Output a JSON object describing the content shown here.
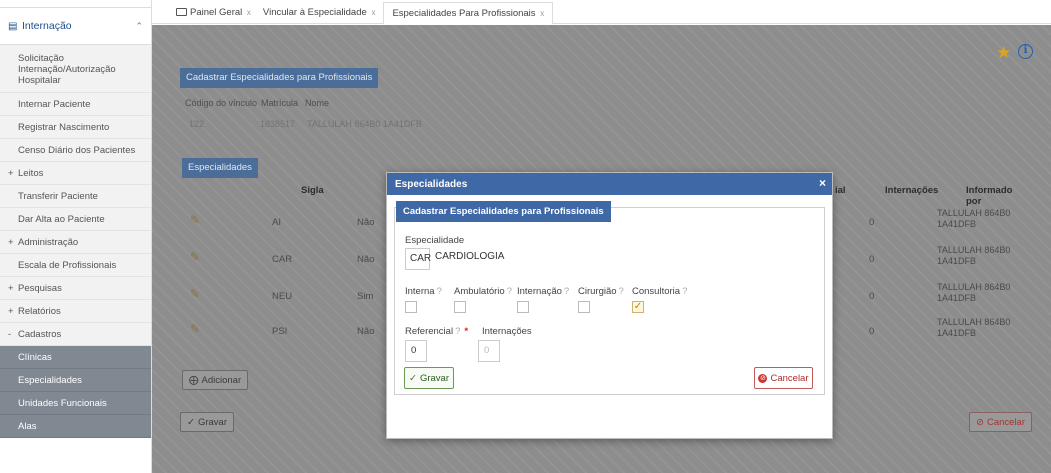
{
  "sidebar": {
    "header": "Internação",
    "items": [
      {
        "label": "Solicitação Internação/Autorização Hospitalar"
      },
      {
        "label": "Internar Paciente"
      },
      {
        "label": "Registrar Nascimento"
      },
      {
        "label": "Censo Diário dos Pacientes"
      },
      {
        "label": "Leitos",
        "sign": "+"
      },
      {
        "label": "Transferir Paciente"
      },
      {
        "label": "Dar Alta ao Paciente"
      },
      {
        "label": "Administração",
        "sign": "+"
      },
      {
        "label": "Escala de Profissionais"
      },
      {
        "label": "Pesquisas",
        "sign": "+"
      },
      {
        "label": "Relatórios",
        "sign": "+"
      },
      {
        "label": "Cadastros",
        "sign": "-"
      },
      {
        "label": "Clínicas"
      },
      {
        "label": "Especialidades"
      },
      {
        "label": "Unidades Funcionais"
      },
      {
        "label": "Alas"
      }
    ]
  },
  "tabs": [
    {
      "label": "Painel Geral",
      "close": "x"
    },
    {
      "label": "Vincular à Especialidade",
      "close": "x"
    },
    {
      "label": "Especialidades Para Profissionais",
      "close": "x"
    }
  ],
  "background": {
    "panel1_title": "Cadastrar Especialidades para Profissionais",
    "col_codigo": "Código do vínculo",
    "col_matricula": "Matrícula",
    "col_nome": "Nome",
    "val_codigo": "122",
    "val_matricula": "1838517",
    "val_nome": "TALLULAH 864B0 1A41DFB",
    "panel2_title": "Especialidades",
    "th_sigla": "Sigla",
    "th_partial": "ial",
    "th_internacoes": "Internações",
    "th_informado": "Informado por",
    "rows": [
      {
        "sigla": "AI",
        "flag": "Não",
        "intern": "0",
        "informado": "TALLULAH 864B0 1A41DFB"
      },
      {
        "sigla": "CAR",
        "flag": "Não",
        "intern": "0",
        "informado": "TALLULAH 864B0 1A41DFB"
      },
      {
        "sigla": "NEU",
        "flag": "Sim",
        "intern": "0",
        "informado": "TALLULAH 864B0 1A41DFB"
      },
      {
        "sigla": "PSI",
        "flag": "Não",
        "intern": "0",
        "informado": "TALLULAH 864B0 1A41DFB"
      }
    ],
    "btn_adicionar": "Adicionar",
    "btn_gravar": "Gravar",
    "btn_cancelar": "Cancelar"
  },
  "modal": {
    "title": "Especialidades",
    "close": "×",
    "inner_title": "Cadastrar Especialidades para Profissionais",
    "especialidade_label": "Especialidade",
    "especialidade_code": "CAR",
    "especialidade_name": "CARDIOLOGIA",
    "checkboxes": [
      {
        "label": "Interna",
        "checked": false
      },
      {
        "label": "Ambulatório",
        "checked": false
      },
      {
        "label": "Internação",
        "checked": false
      },
      {
        "label": "Cirurgião",
        "checked": false
      },
      {
        "label": "Consultoria",
        "checked": true
      }
    ],
    "help_mark": "?",
    "referencial_label": "Referencial",
    "required_mark": "*",
    "referencial_value": "0",
    "internacoes_label": "Internações",
    "internacoes_value": "0",
    "btn_gravar": "Gravar",
    "btn_cancelar": "Cancelar"
  },
  "colors": {
    "accent": "#3f68a6",
    "sidebar_active": "#808892",
    "cancel": "#b32c2c",
    "save": "#2c5a1e"
  }
}
